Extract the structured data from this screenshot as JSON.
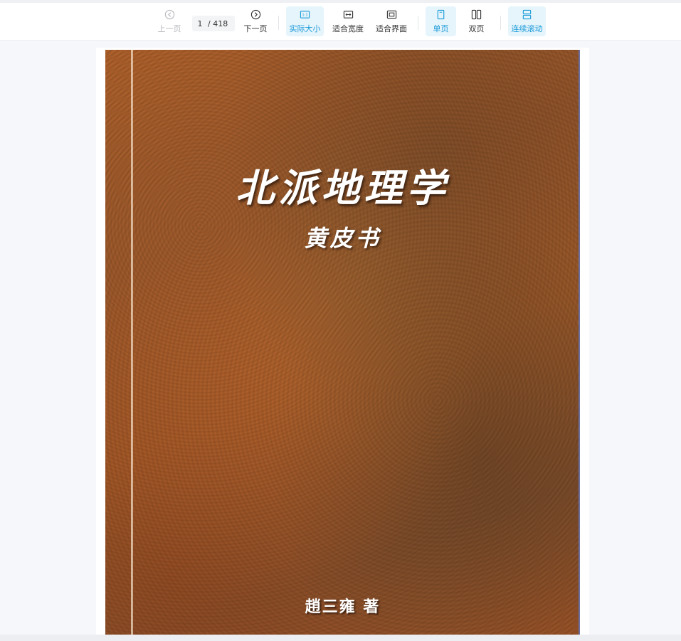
{
  "toolbar": {
    "prev_label": "上一页",
    "next_label": "下一页",
    "current_page": "1",
    "total_pages": "/ 418",
    "actual_size_label": "实际大小",
    "actual_size_icon_text": "1:1",
    "fit_width_label": "适合宽度",
    "fit_page_label": "适合界面",
    "single_page_label": "单页",
    "double_page_label": "双页",
    "continuous_scroll_label": "连续滚动"
  },
  "cover": {
    "title": "北派地理学",
    "subtitle": "黄皮书",
    "author": "趙三雍 著"
  },
  "icons": [
    "chevron-left-circle-icon",
    "chevron-right-circle-icon",
    "actual-size-icon",
    "fit-width-icon",
    "fit-page-icon",
    "single-page-icon",
    "double-page-icon",
    "continuous-scroll-icon"
  ],
  "colors": {
    "accent": "#1a9bd8",
    "active_bg": "#e6f4fc",
    "disabled": "#b6b9be"
  }
}
